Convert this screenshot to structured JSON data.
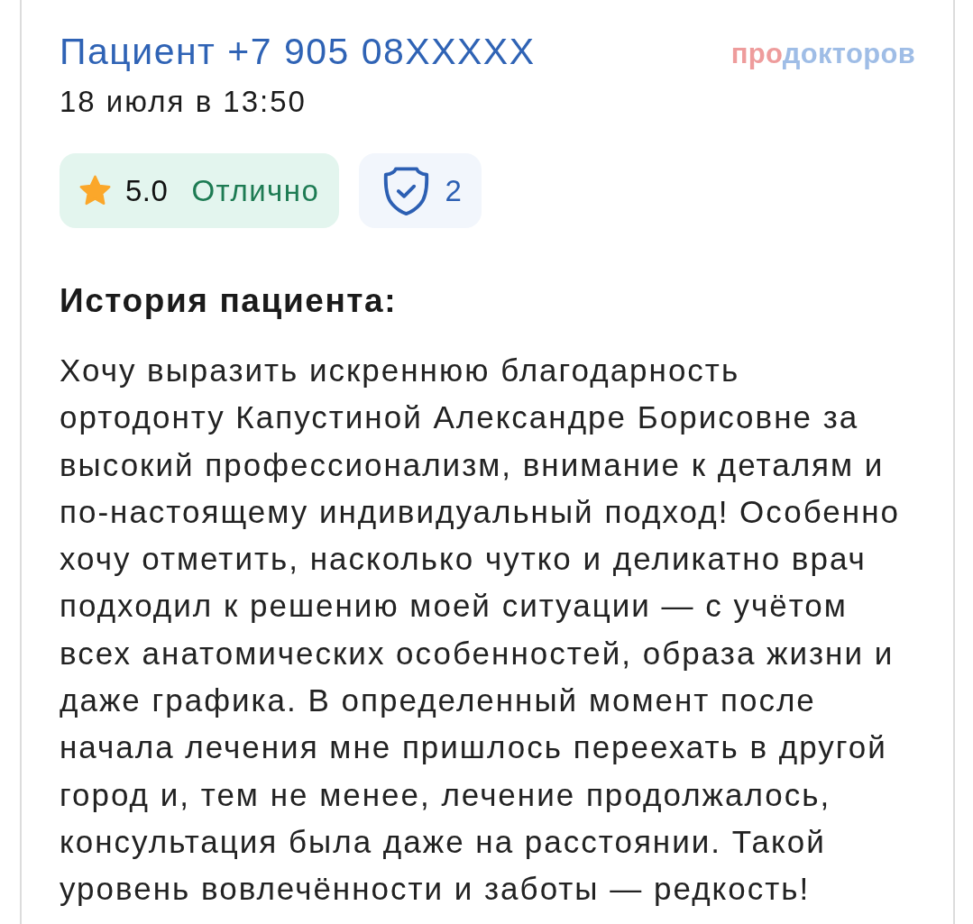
{
  "review": {
    "author": "Пациент +7 905 08XXXXX",
    "date": "18 июля в 13:50",
    "logo": {
      "prefix": "про",
      "suffix": "докторов"
    }
  },
  "badges": [
    {
      "kind": "rating",
      "value": "5.0",
      "label": "Отлично"
    },
    {
      "kind": "verified",
      "value": "2"
    }
  ],
  "story": {
    "heading": "История пациента:",
    "lines": [
      "Хочу выразить искреннюю благодарность",
      "ортодонту Капустиной Александре Борисовне за",
      "высокий профессионализм, внимание к деталям и",
      "по-настоящему индивидуальный подход! Особенно",
      "хочу отметить, насколько чутко и деликатно врач",
      "подходил к решению моей ситуации — с учётом",
      "всех анатомических особенностей, образа жизни и",
      "даже графика. В определенный момент после",
      "начала лечения мне пришлось переехать в другой",
      "город и, тем не менее, лечение продолжалось,",
      "консультация была даже на расстоянии. Такой",
      "уровень вовлечённости и заботы — редкость!"
    ]
  }
}
